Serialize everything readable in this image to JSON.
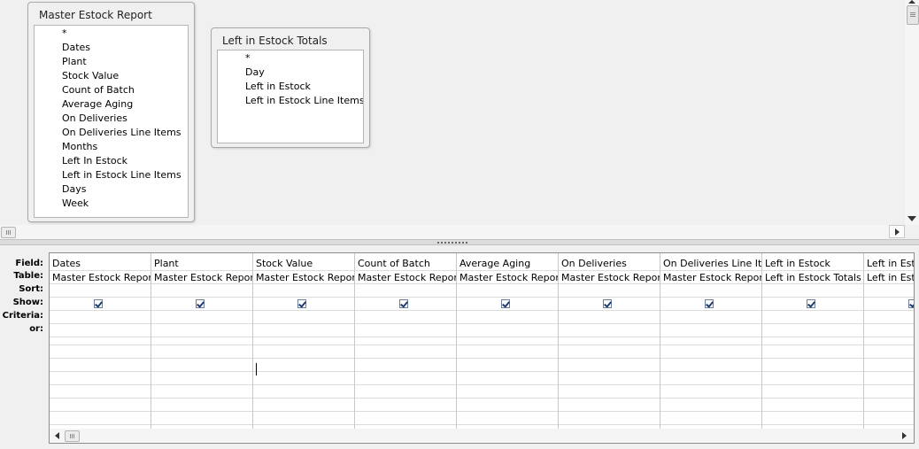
{
  "tables": [
    {
      "title": "Master Estock Report",
      "fields": [
        "*",
        "Dates",
        "Plant",
        "Stock Value",
        "Count of Batch",
        "Average Aging",
        "On Deliveries",
        "On Deliveries Line Items",
        "Months",
        "Left In Estock",
        "Left in Estock Line Items",
        "Days",
        "Week"
      ]
    },
    {
      "title": "Left in Estock Totals",
      "fields": [
        "*",
        "Day",
        "Left in Estock",
        "Left in Estock Line Items"
      ]
    }
  ],
  "grid": {
    "row_labels": {
      "field": "Field:",
      "table": "Table:",
      "sort": "Sort:",
      "show": "Show:",
      "criteria": "Criteria:",
      "or": "or:"
    },
    "columns": [
      {
        "field": "Dates",
        "table": "Master Estock Report",
        "show": true
      },
      {
        "field": "Plant",
        "table": "Master Estock Report",
        "show": true
      },
      {
        "field": "Stock Value",
        "table": "Master Estock Report",
        "show": true
      },
      {
        "field": "Count of Batch",
        "table": "Master Estock Report",
        "show": true
      },
      {
        "field": "Average Aging",
        "table": "Master Estock Report",
        "show": true
      },
      {
        "field": "On Deliveries",
        "table": "Master Estock Report",
        "show": true
      },
      {
        "field": "On Deliveries Line Iter",
        "table": "Master Estock Report",
        "show": true
      },
      {
        "field": "Left in Estock",
        "table": "Left in Estock Totals",
        "show": true
      },
      {
        "field": "Left in Esto",
        "table": "Left in Esto",
        "show": true
      }
    ]
  },
  "icons": {
    "scroll_up": "arrow-up-icon",
    "scroll_down": "arrow-down-icon",
    "scroll_left": "arrow-left-icon",
    "scroll_right": "arrow-right-icon",
    "check": "checkmark-icon"
  }
}
